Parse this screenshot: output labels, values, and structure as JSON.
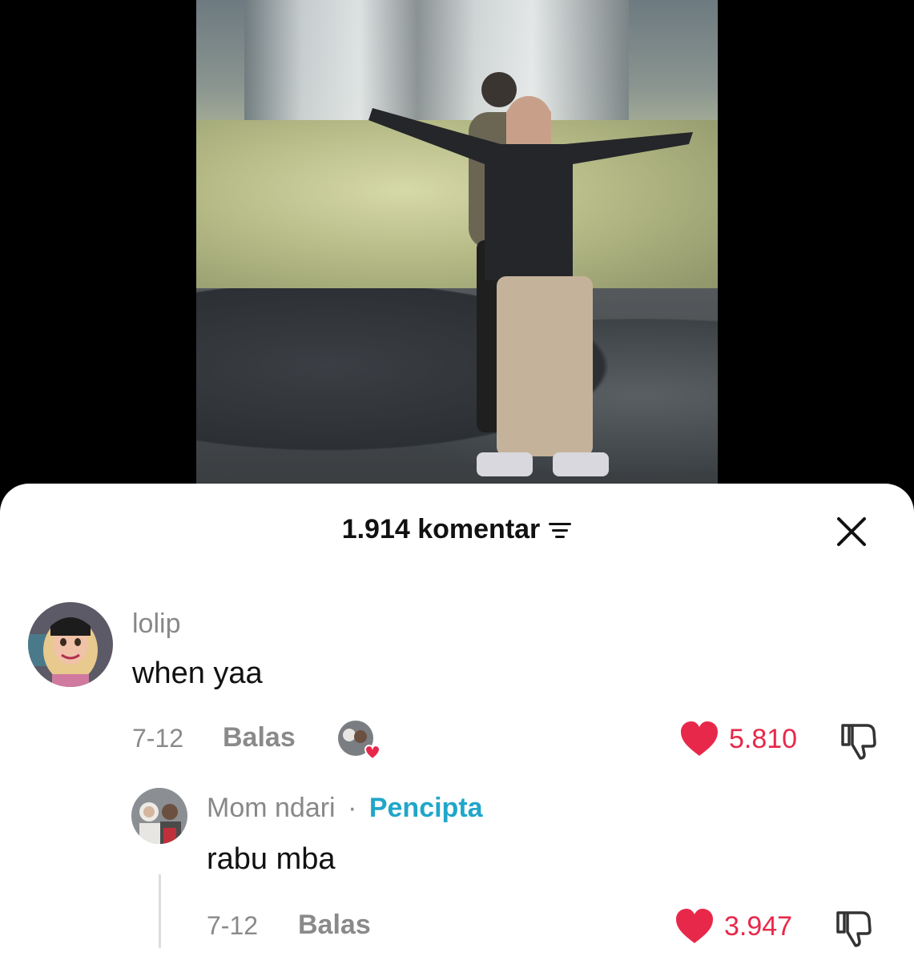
{
  "header": {
    "comment_count_label": "1.914 komentar"
  },
  "comments": [
    {
      "username": "lolip",
      "text": "when yaa",
      "date": "7-12",
      "reply_label": "Balas",
      "likes": "5.810"
    }
  ],
  "replies": [
    {
      "username": "Mom ndari",
      "separator": "·",
      "badge": "Pencipta",
      "text": "rabu mba",
      "date": "7-12",
      "reply_label": "Balas",
      "likes": "3.947"
    }
  ],
  "colors": {
    "like": "#e8284a",
    "creator_badge": "#21a6c9"
  },
  "icons": [
    "filter-icon",
    "close-icon",
    "heart-icon",
    "dislike-icon",
    "creator-liked-icon"
  ]
}
